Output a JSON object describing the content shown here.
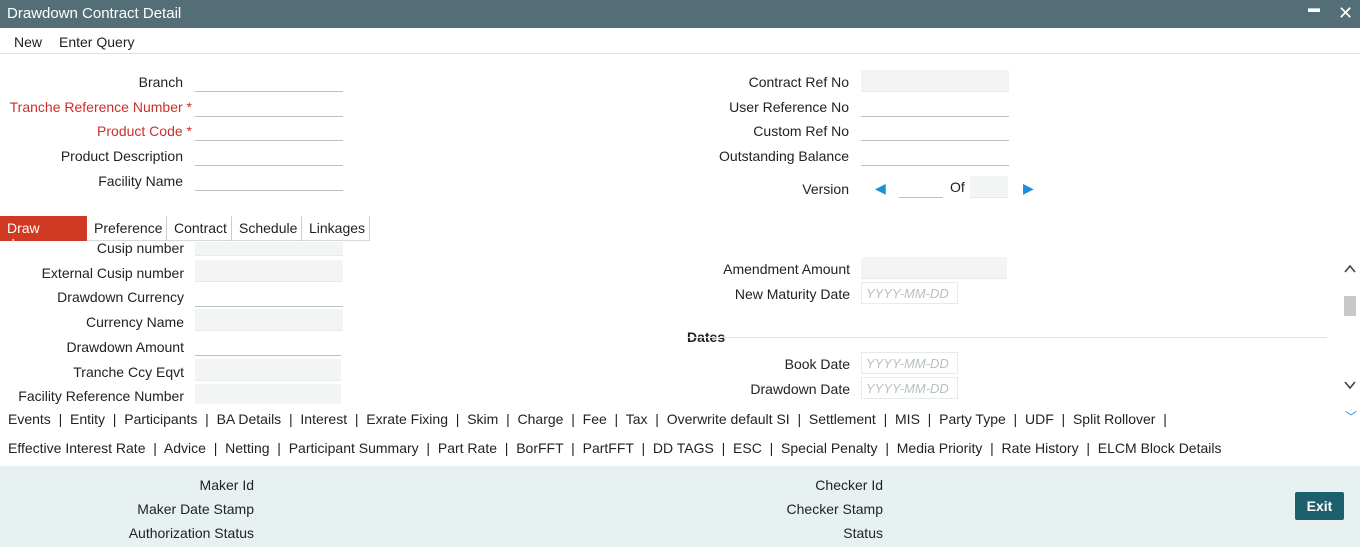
{
  "window": {
    "title": "Drawdown Contract Detail",
    "minimize": "▬",
    "close": "✕"
  },
  "menu": {
    "new": "New",
    "enter_query": "Enter Query"
  },
  "header_left": {
    "branch": "Branch",
    "tranche_ref": "Tranche Reference Number",
    "product_code": "Product Code",
    "product_desc": "Product Description",
    "facility_name": "Facility Name",
    "required_mark": "*"
  },
  "header_right": {
    "contract_ref": "Contract Ref No",
    "user_ref": "User Reference No",
    "custom_ref": "Custom Ref No",
    "outstanding": "Outstanding Balance",
    "version": "Version",
    "of": "Of"
  },
  "tabs": [
    "Draw downs",
    "Preference",
    "Contract",
    "Schedule",
    "Linkages"
  ],
  "drawdowns": {
    "cusip": "Cusip number",
    "ext_cusip": "External Cusip number",
    "currency": "Drawdown Currency",
    "currency_name": "Currency Name",
    "amount": "Drawdown Amount",
    "tranche_ccy": "Tranche Ccy Eqvt",
    "facility_ref": "Facility Reference Number",
    "amendment_amount": "Amendment Amount",
    "new_maturity": "New Maturity Date",
    "dates_title": "Dates",
    "book_date": "Book Date",
    "drawdown_date": "Drawdown Date",
    "date_placeholder": "YYYY-MM-DD"
  },
  "links_row1": [
    "Events",
    "Entity",
    "Participants",
    "BA Details",
    "Interest",
    "Exrate Fixing",
    "Skim",
    "Charge",
    "Fee",
    "Tax",
    "Overwrite default SI",
    "Settlement",
    "MIS",
    "Party Type",
    "UDF",
    "Split Rollover"
  ],
  "links_row2": [
    "Effective Interest Rate",
    "Advice",
    "Netting",
    "Participant Summary",
    "Part Rate",
    "BorFFT",
    "PartFFT",
    "DD TAGS",
    "ESC",
    "Special Penalty",
    "Media Priority",
    "Rate History",
    "ELCM Block Details"
  ],
  "footer": {
    "maker_id": "Maker Id",
    "maker_stamp": "Maker Date Stamp",
    "auth_status": "Authorization Status",
    "checker_id": "Checker Id",
    "checker_stamp": "Checker Stamp",
    "status": "Status",
    "exit": "Exit"
  }
}
